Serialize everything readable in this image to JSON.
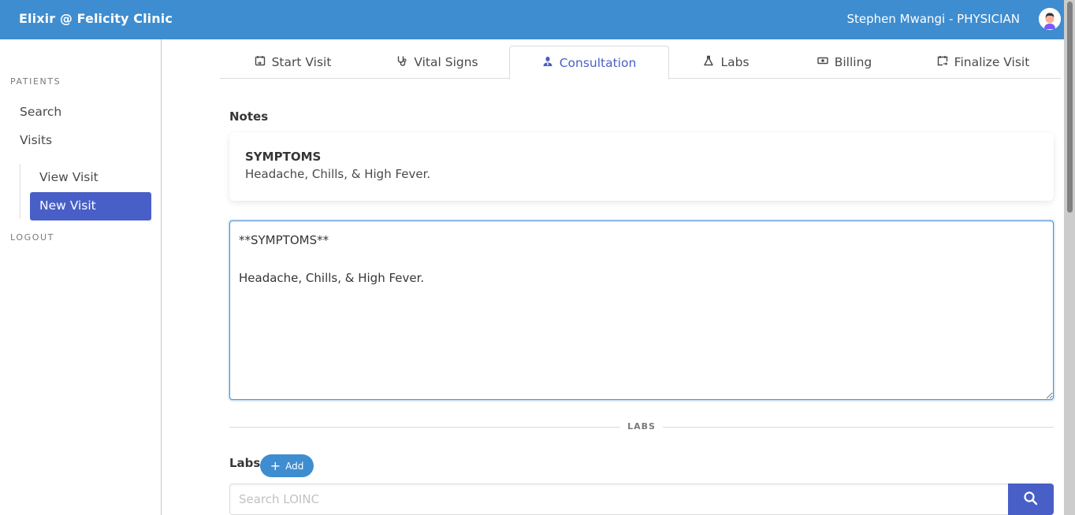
{
  "header": {
    "brand": "Elixir @ Felicity Clinic",
    "user": "Stephen Mwangi - PHYSICIAN",
    "avatar_icon": "user-avatar-icon",
    "color": "#3e8dd0"
  },
  "sidebar": {
    "section_label": "PATIENTS",
    "items": [
      {
        "label": "Search"
      },
      {
        "label": "Visits"
      }
    ],
    "subitems": [
      {
        "label": "View Visit",
        "active": false
      },
      {
        "label": "New Visit",
        "active": true
      }
    ],
    "logout_label": "LOGOUT",
    "active_color": "#485fc7"
  },
  "tabs": [
    {
      "label": "Start Visit",
      "icon": "calendar-start-icon",
      "active": false
    },
    {
      "label": "Vital Signs",
      "icon": "stethoscope-icon",
      "active": false
    },
    {
      "label": "Consultation",
      "icon": "doctor-icon",
      "active": true
    },
    {
      "label": "Labs",
      "icon": "flask-icon",
      "active": false
    },
    {
      "label": "Billing",
      "icon": "money-icon",
      "active": false
    },
    {
      "label": "Finalize Visit",
      "icon": "calendar-finalize-icon",
      "active": false
    }
  ],
  "notes": {
    "title": "Notes",
    "preview_heading": "SYMPTOMS",
    "preview_text": "Headache, Chills, & High Fever.",
    "editor_value": "**SYMPTOMS**\n\nHeadache, Chills, & High Fever."
  },
  "labs": {
    "divider_label": "LABS",
    "title": "Labs",
    "add_label": "Add",
    "search_placeholder": "Search LOINC",
    "search_value": ""
  }
}
